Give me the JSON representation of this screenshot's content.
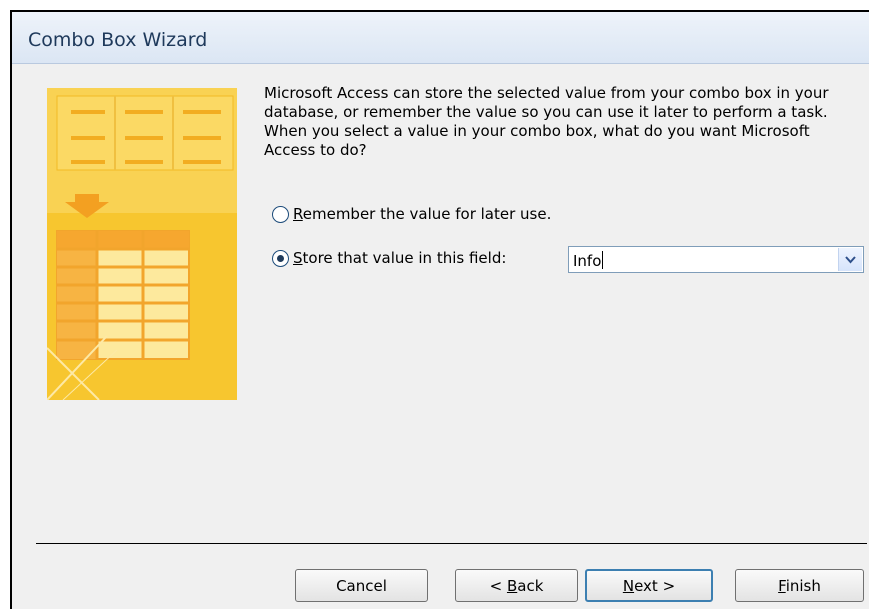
{
  "window": {
    "title": "Combo Box Wizard"
  },
  "prompt": "Microsoft Access can store the selected value from your combo box in your database, or remember the value so you can use it later to perform a task.  When you select a value in your combo box, what do you want Microsoft Access to do?",
  "options": [
    {
      "mnemonic": "R",
      "label_rest": "emember the value for later use.",
      "selected": false
    },
    {
      "mnemonic": "S",
      "label_rest": "tore that value in this field:",
      "selected": true
    }
  ],
  "field_select": {
    "value": "Info"
  },
  "buttons": {
    "cancel": {
      "label": "Cancel"
    },
    "back": {
      "prefix": "< ",
      "mnemonic": "B",
      "rest": "ack"
    },
    "next": {
      "mnemonic": "N",
      "rest": "ext >"
    },
    "finish": {
      "mnemonic": "F",
      "rest": "inish"
    }
  },
  "colors": {
    "illustration": "#f7c62f",
    "default_button_border": "#3c7fb1"
  }
}
